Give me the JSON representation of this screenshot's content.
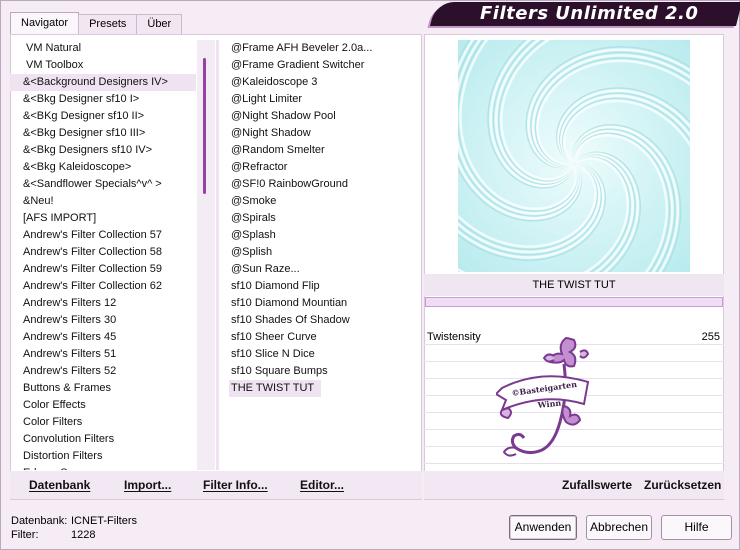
{
  "window": {
    "title": "Filters Unlimited 2.0"
  },
  "tabs": [
    {
      "label": "Navigator"
    },
    {
      "label": "Presets"
    },
    {
      "label": "Über"
    }
  ],
  "categories": [
    {
      "label": "VM Natural",
      "indent": true
    },
    {
      "label": "VM Toolbox",
      "indent": true
    },
    {
      "label": "&<Background Designers IV>",
      "selected": true
    },
    {
      "label": "&<Bkg Designer sf10 I>"
    },
    {
      "label": "&<BKg Designer sf10 II>"
    },
    {
      "label": "&<Bkg Designer sf10 III>"
    },
    {
      "label": "&<Bkg Designers sf10 IV>"
    },
    {
      "label": "&<Bkg Kaleidoscope>"
    },
    {
      "label": "&<Sandflower Specials^v^ >"
    },
    {
      "label": "&Neu!"
    },
    {
      "label": "[AFS IMPORT]"
    },
    {
      "label": "Andrew's Filter Collection 57"
    },
    {
      "label": "Andrew's Filter Collection 58"
    },
    {
      "label": "Andrew's Filter Collection 59"
    },
    {
      "label": "Andrew's Filter Collection 62"
    },
    {
      "label": "Andrew's Filters 12"
    },
    {
      "label": "Andrew's Filters 30"
    },
    {
      "label": "Andrew's Filters 45"
    },
    {
      "label": "Andrew's Filters 51"
    },
    {
      "label": "Andrew's Filters 52"
    },
    {
      "label": "Buttons & Frames"
    },
    {
      "label": "Color Effects"
    },
    {
      "label": "Color Filters"
    },
    {
      "label": "Convolution Filters"
    },
    {
      "label": "Distortion Filters"
    },
    {
      "label": "Edges, Square"
    }
  ],
  "filters": [
    {
      "label": "@Frame AFH Beveler 2.0a..."
    },
    {
      "label": "@Frame Gradient Switcher"
    },
    {
      "label": "@Kaleidoscope 3"
    },
    {
      "label": "@Light Limiter"
    },
    {
      "label": "@Night Shadow Pool"
    },
    {
      "label": "@Night Shadow"
    },
    {
      "label": "@Random Smelter"
    },
    {
      "label": "@Refractor"
    },
    {
      "label": "@SF!0 RainbowGround"
    },
    {
      "label": "@Smoke"
    },
    {
      "label": "@Spirals"
    },
    {
      "label": "@Splash"
    },
    {
      "label": "@Splish"
    },
    {
      "label": "@Sun Raze..."
    },
    {
      "label": "sf10 Diamond Flip"
    },
    {
      "label": "sf10 Diamond Mountian"
    },
    {
      "label": "sf10 Shades Of Shadow"
    },
    {
      "label": "sf10 Sheer Curve"
    },
    {
      "label": "sf10 Slice N Dice"
    },
    {
      "label": "sf10 Square Bumps"
    },
    {
      "label": "THE TWIST TUT",
      "selected": true
    }
  ],
  "left_footer": {
    "database": "Datenbank",
    "import": "Import...",
    "filter_info": "Filter Info...",
    "editor": "Editor..."
  },
  "preview": {
    "filter_name": "THE TWIST TUT",
    "progress": 0,
    "colors": {
      "base": "#c9f1f2",
      "light": "#ecfbfb",
      "dark": "#9fdde0"
    }
  },
  "params": [
    {
      "label": "Twistensity",
      "value": "255"
    }
  ],
  "right_footer": {
    "randomize": "Zufallswerte",
    "reset": "Zurücksetzen"
  },
  "watermark": {
    "text_line1": "©Basteigarten",
    "text_line2": "Winn",
    "color": "#7a3a8f"
  },
  "status": {
    "database_label": "Datenbank:",
    "database_value": "ICNET-Filters",
    "filter_label": "Filter:",
    "filter_value": "1228"
  },
  "buttons": {
    "apply": "Anwenden",
    "cancel": "Abbrechen",
    "help": "Hilfe"
  }
}
